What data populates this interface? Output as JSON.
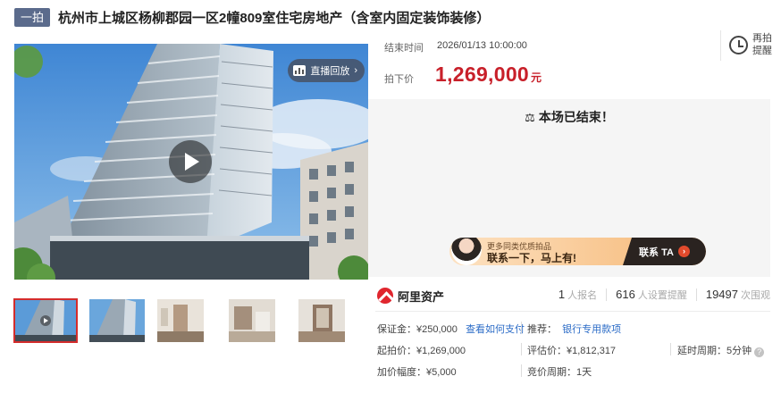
{
  "header": {
    "round_badge": "一拍",
    "title": "杭州市上城区杨柳郡园一区2幢809室住宅房地产（含室内固定装饰装修）"
  },
  "media": {
    "replay_label": "直播回放",
    "thumbnail_count": 5,
    "selected_thumbnail": 1
  },
  "auction": {
    "end_time_label": "结束时间",
    "end_time": "2026/01/13 10:00:00",
    "price_label": "拍下价",
    "price": "1,269,000",
    "price_unit": "元",
    "reminder_label_1": "再拍",
    "reminder_label_2": "提醒",
    "status": "本场已结束！"
  },
  "promo": {
    "small_text": "更多同类优质拍品",
    "main_text": "联系一下，马上有!",
    "cta": "联系 TA"
  },
  "brand": {
    "name": "阿里资产"
  },
  "stats": {
    "registrations": "1",
    "registrations_label": "人报名",
    "reminders": "616",
    "reminders_label": "人设置提醒",
    "views": "19497",
    "views_label": "次围观"
  },
  "details": {
    "deposit": "保证金：¥250,000",
    "deposit_link": "查看如何支付",
    "recommend_label": "推荐：",
    "recommend_link": "银行专用款项",
    "start_price": "起拍价：¥1,269,000",
    "appraisal": "评估价：¥1,812,317",
    "delay": "延时周期：5分钟",
    "increment": "加价幅度：¥5,000",
    "bid_period": "竞价周期：1天"
  },
  "colors": {
    "accent_red": "#c8202a",
    "link_blue": "#2c6cc7",
    "badge": "#5b6b8c"
  }
}
